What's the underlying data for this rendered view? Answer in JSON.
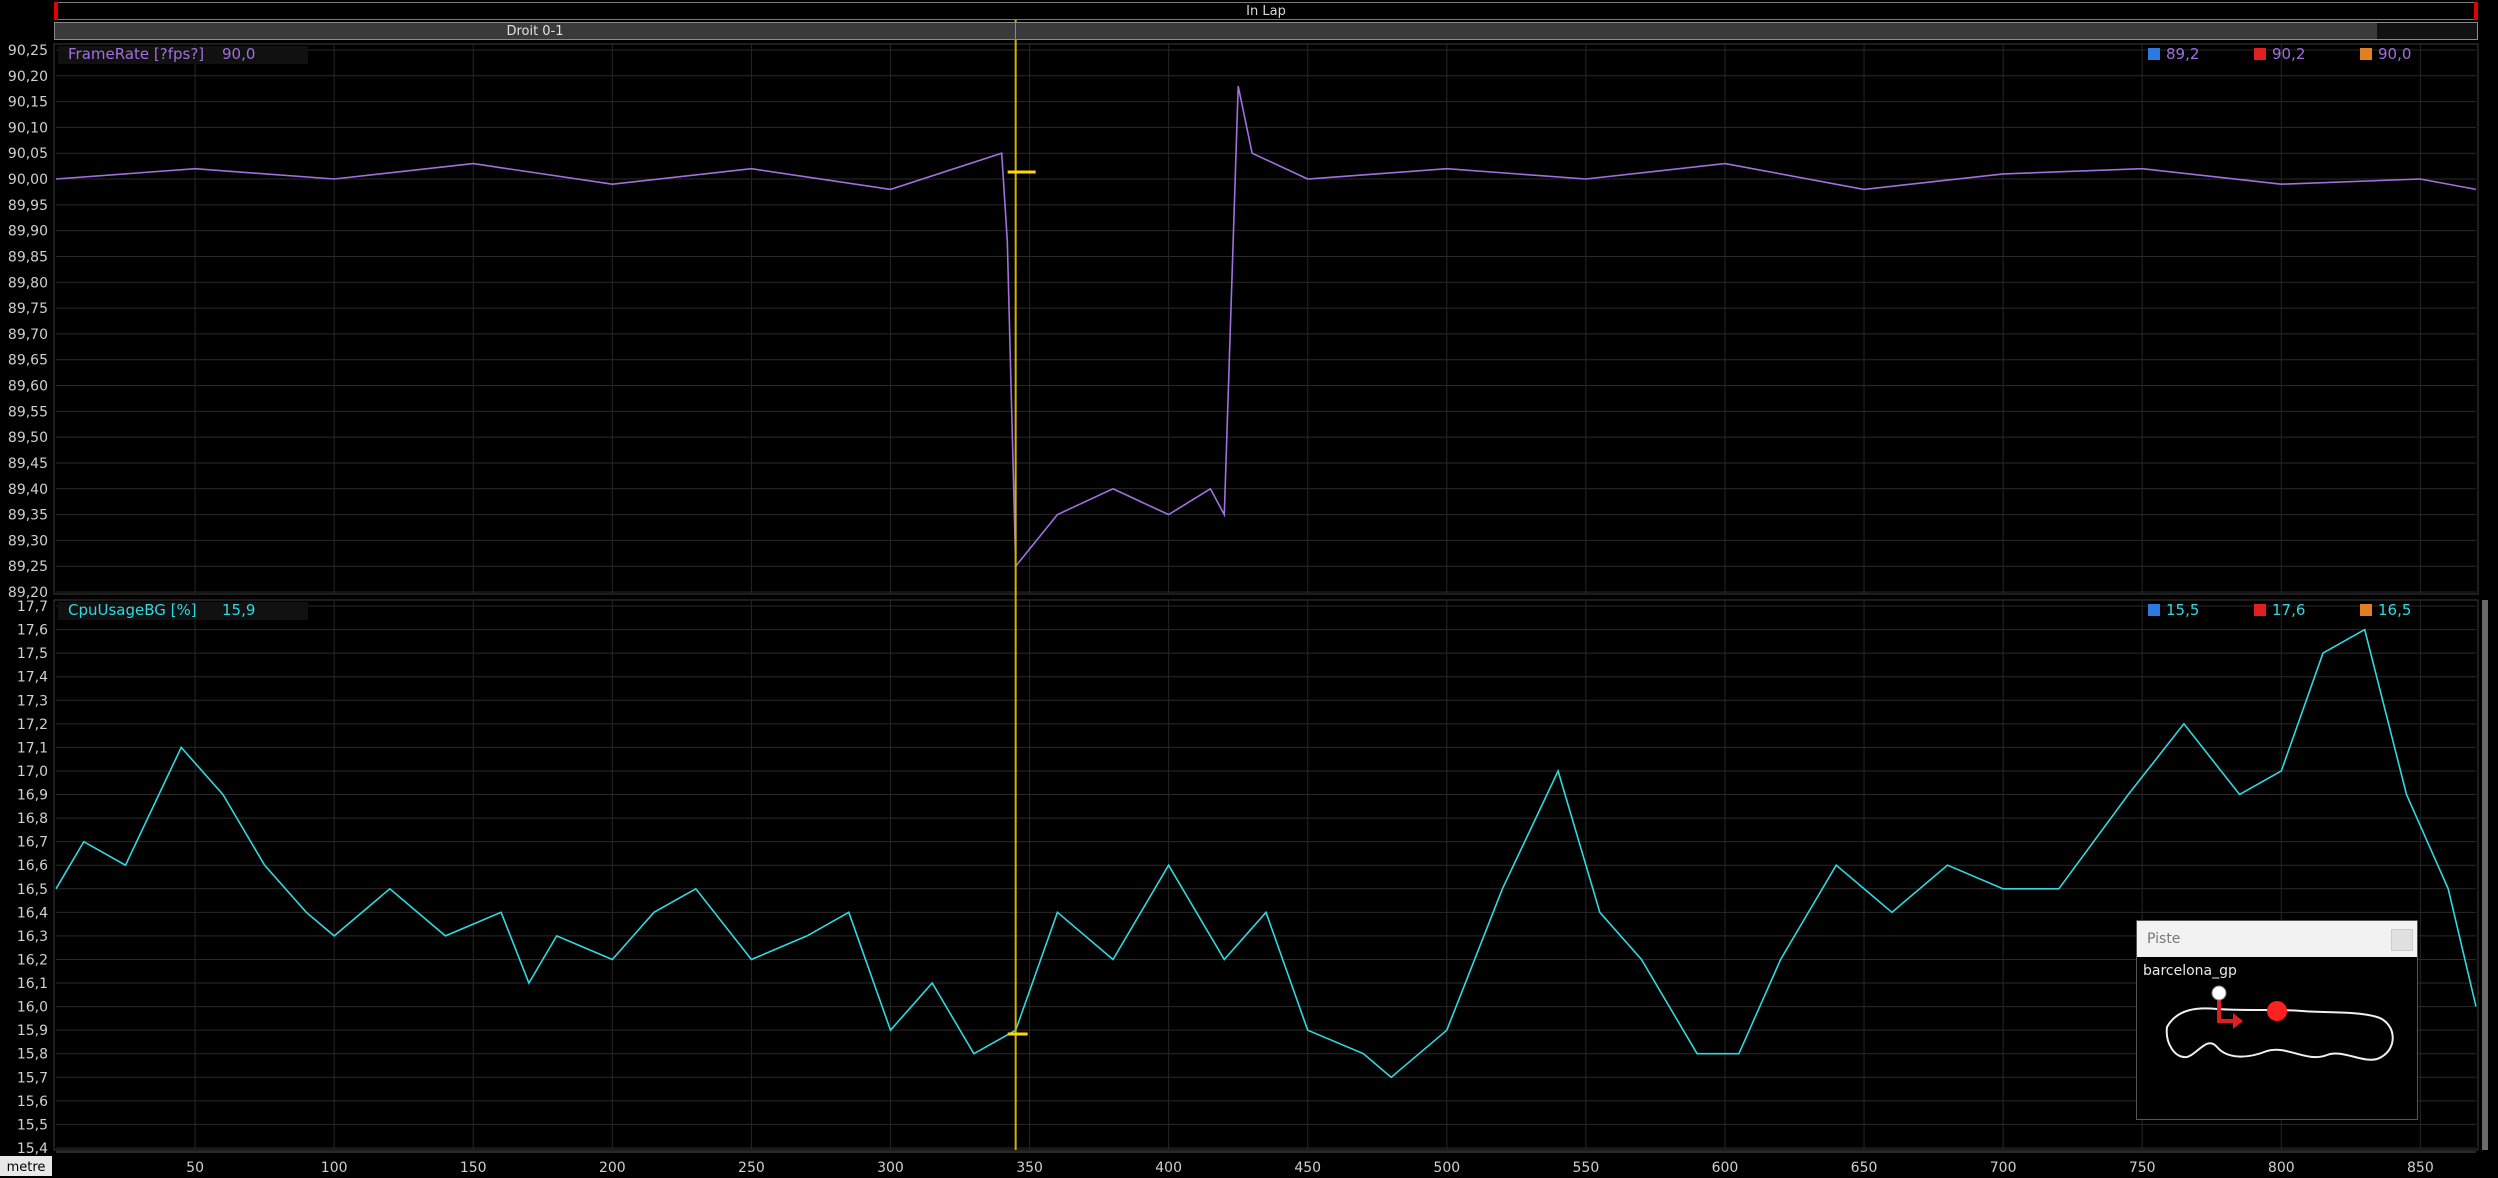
{
  "lap_label": "In Lap",
  "segment_label": "Droit 0-1",
  "unit_label": "metre",
  "chart_data": [
    {
      "type": "line",
      "name": "FrameRate [?fps?]",
      "current_value": "90,0",
      "stats": {
        "min": "89,2",
        "max": "90,2",
        "avg": "90,0"
      },
      "color": "#a070e0",
      "ylim": [
        89.2,
        90.25
      ],
      "yticks": [
        "90,25",
        "90,20",
        "90,15",
        "90,10",
        "90,05",
        "90,00",
        "89,95",
        "89,90",
        "89,85",
        "89,80",
        "89,75",
        "89,70",
        "89,65",
        "89,60",
        "89,55",
        "89,50",
        "89,45",
        "89,40",
        "89,35",
        "89,30",
        "89,25",
        "89,20"
      ],
      "x": [
        0,
        50,
        100,
        150,
        200,
        250,
        300,
        340,
        342,
        345,
        360,
        380,
        400,
        415,
        420,
        425,
        430,
        450,
        500,
        550,
        600,
        650,
        700,
        750,
        800,
        850,
        870
      ],
      "y": [
        90.0,
        90.02,
        90.0,
        90.03,
        89.99,
        90.02,
        89.98,
        90.05,
        89.88,
        89.25,
        89.35,
        89.4,
        89.35,
        89.4,
        89.35,
        90.18,
        90.05,
        90.0,
        90.02,
        90.0,
        90.03,
        89.98,
        90.01,
        90.02,
        89.99,
        90.0,
        89.98
      ]
    },
    {
      "type": "line",
      "name": "CpuUsageBG [%]",
      "current_value": "15,9",
      "stats": {
        "min": "15,5",
        "max": "17,6",
        "avg": "16,5"
      },
      "color": "#30d8e0",
      "ylim": [
        15.4,
        17.7
      ],
      "yticks": [
        "17,7",
        "17,6",
        "17,5",
        "17,4",
        "17,3",
        "17,2",
        "17,1",
        "17,0",
        "16,9",
        "16,8",
        "16,7",
        "16,6",
        "16,5",
        "16,4",
        "16,3",
        "16,2",
        "16,1",
        "16,0",
        "15,9",
        "15,8",
        "15,7",
        "15,6",
        "15,5",
        "15,4"
      ],
      "x": [
        0,
        10,
        25,
        45,
        60,
        75,
        90,
        100,
        120,
        140,
        160,
        170,
        180,
        200,
        215,
        230,
        250,
        270,
        285,
        300,
        315,
        330,
        345,
        360,
        380,
        400,
        420,
        435,
        450,
        470,
        480,
        500,
        520,
        540,
        555,
        570,
        590,
        605,
        620,
        640,
        660,
        680,
        700,
        720,
        745,
        765,
        785,
        800,
        815,
        830,
        845,
        860,
        870
      ],
      "y": [
        16.5,
        16.7,
        16.6,
        17.1,
        16.9,
        16.6,
        16.4,
        16.3,
        16.5,
        16.3,
        16.4,
        16.1,
        16.3,
        16.2,
        16.4,
        16.5,
        16.2,
        16.3,
        16.4,
        15.9,
        16.1,
        15.8,
        15.9,
        16.4,
        16.2,
        16.6,
        16.2,
        16.4,
        15.9,
        15.8,
        15.7,
        15.9,
        16.5,
        17.0,
        16.4,
        16.2,
        15.8,
        15.8,
        16.2,
        16.6,
        16.4,
        16.6,
        16.5,
        16.5,
        16.9,
        17.2,
        16.9,
        17.0,
        17.5,
        17.6,
        16.9,
        16.5,
        16.0
      ]
    }
  ],
  "x_axis": {
    "min": 0,
    "max": 870,
    "ticks": [
      50,
      100,
      150,
      200,
      250,
      300,
      350,
      400,
      450,
      500,
      550,
      600,
      650,
      700,
      750,
      800,
      850
    ]
  },
  "cursor_x": 345,
  "piste": {
    "title": "Piste",
    "track": "barcelona_gp"
  }
}
